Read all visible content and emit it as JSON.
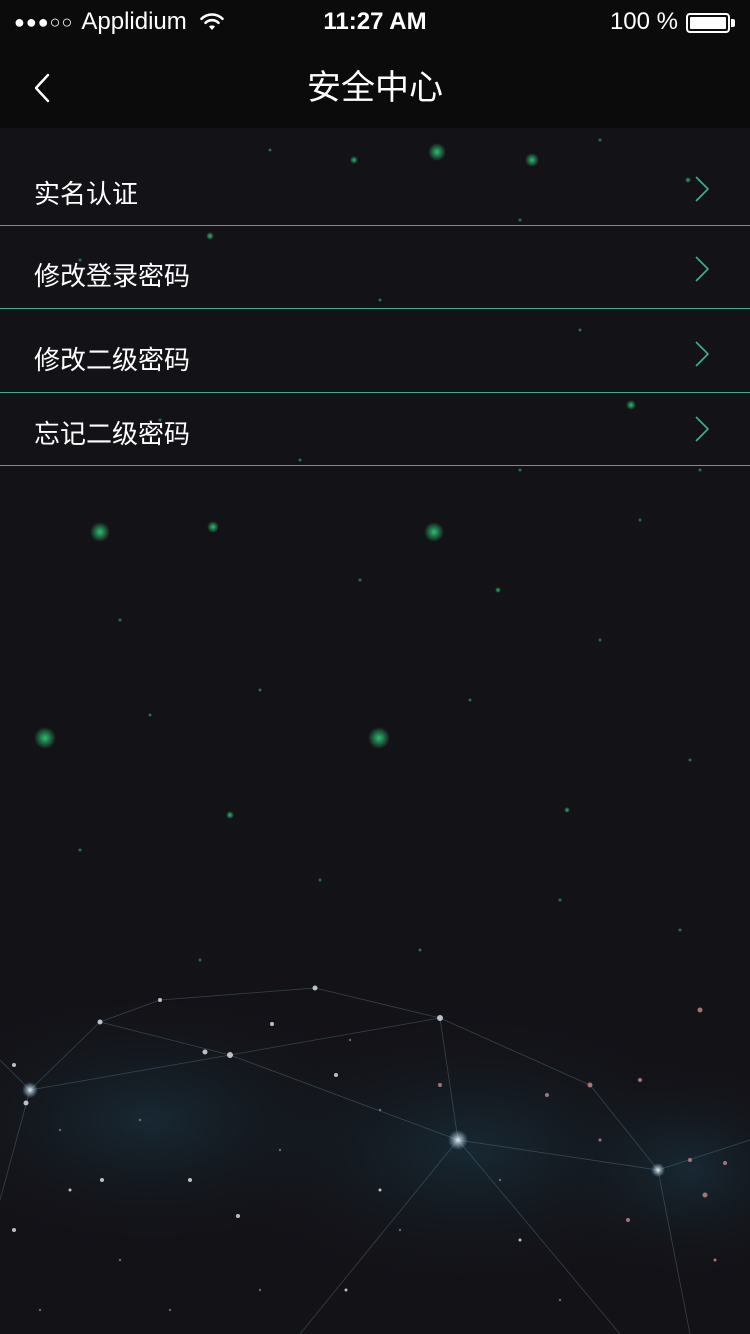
{
  "status_bar": {
    "signal": "●●●○○",
    "carrier": "Applidium",
    "time": "11:27 AM",
    "battery_percent": "100 %",
    "battery_level": 1.0,
    "icons": [
      "wifi-icon",
      "battery-icon"
    ]
  },
  "nav": {
    "title": "安全中心",
    "back_icon": "chevron-left-icon"
  },
  "menu": {
    "items": [
      {
        "label": "实名认证",
        "icon": "chevron-right-icon"
      },
      {
        "label": "修改登录密码",
        "icon": "chevron-right-icon"
      },
      {
        "label": "修改二级密码",
        "icon": "chevron-right-icon"
      },
      {
        "label": "忘记二级密码",
        "icon": "chevron-right-icon"
      }
    ]
  },
  "colors": {
    "background": "#131217",
    "bar_background": "#0b0b0c",
    "divider": "#3bb08f",
    "chevron": "#3bb08f",
    "text": "#ffffff"
  }
}
